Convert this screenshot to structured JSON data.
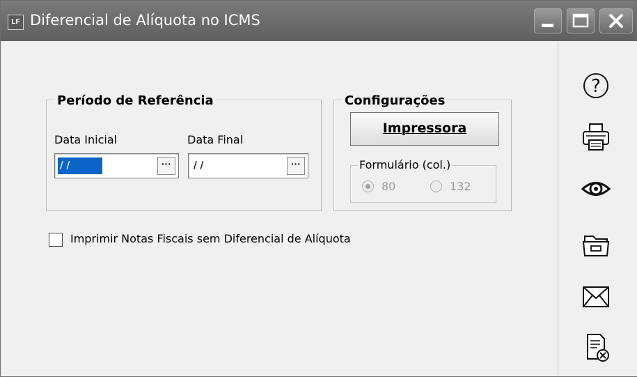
{
  "window": {
    "app_icon_text": "LF",
    "title": "Diferencial de Alíquota no ICMS"
  },
  "periodo": {
    "title": "Período de Referência",
    "data_inicial_label": "Data Inicial",
    "data_inicial_value": "/ /",
    "data_final_label": "Data Final",
    "data_final_value": "/ /",
    "ellipsis": "···"
  },
  "config": {
    "title": "Configurações",
    "impressora_label": "Impressora",
    "formulario_title": "Formulário (col.)",
    "options": [
      "80",
      "132"
    ],
    "selected": "80"
  },
  "checkbox": {
    "label": "Imprimir Notas Fiscais sem Diferencial de Alíquota",
    "checked": false
  },
  "toolbar": {
    "icons": [
      "help-icon",
      "printer-icon",
      "preview-icon",
      "archive-icon",
      "mail-icon",
      "close-document-icon"
    ]
  }
}
